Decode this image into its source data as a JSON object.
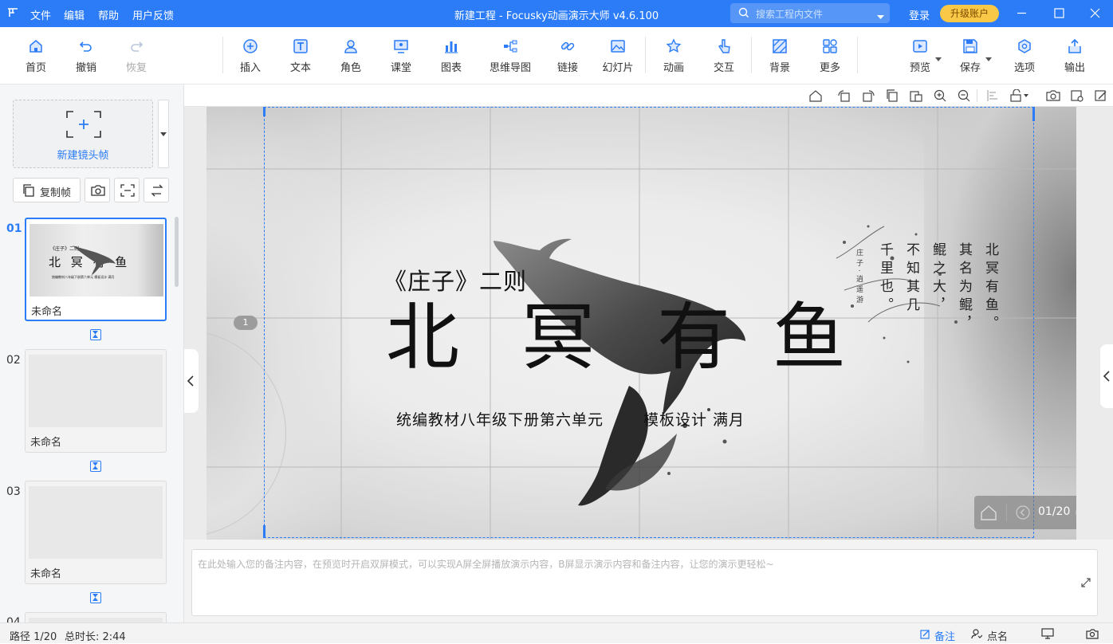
{
  "titlebar": {
    "menus": [
      "文件",
      "编辑",
      "帮助",
      "用户反馈"
    ],
    "title": "新建工程 - Focusky动画演示大师  v4.6.100",
    "search_placeholder": "搜索工程内文件",
    "login": "登录",
    "upgrade": "升级账户"
  },
  "toolbar": {
    "home": "首页",
    "undo": "撤销",
    "redo": "恢复",
    "insert": "插入",
    "text": "文本",
    "role": "角色",
    "classroom": "课堂",
    "chart": "图表",
    "mindmap": "思维导图",
    "link": "链接",
    "slideshow": "幻灯片",
    "animation": "动画",
    "interact": "交互",
    "background": "背景",
    "more": "更多",
    "preview": "预览",
    "save": "保存",
    "options": "选项",
    "export": "输出"
  },
  "leftpanel": {
    "new_frame": "新建镜头帧",
    "copy_frame": "复制帧",
    "frames": [
      {
        "no": "01",
        "name": "未命名"
      },
      {
        "no": "02",
        "name": "未命名"
      },
      {
        "no": "03",
        "name": "未命名"
      },
      {
        "no": "04",
        "name": ""
      }
    ],
    "thumb1": {
      "small_title": "《庄子》二则",
      "big_title": "北 冥 有 鱼",
      "subtitle": "统编教材八年级下册第六单元   模板设计 满月"
    }
  },
  "slide": {
    "small_title": "《庄子》二则",
    "big_chars": [
      "北",
      "冥",
      "有",
      "鱼"
    ],
    "subtitle": "统编教材八年级下册第六单元",
    "design": "模板设计 满月",
    "vertical_poem": [
      "北冥有鱼。",
      "其名为鲲，",
      "鲲之大，",
      "不知其几",
      "千里也。"
    ],
    "side_vertical": [
      "庄子·逍遥游"
    ],
    "frame_marker": "1",
    "nav_page": "01/20"
  },
  "notes": {
    "placeholder": "在此处输入您的备注内容，在预览时开启双屏模式，可以实现A屏全屏播放演示内容，B屏显示演示内容和备注内容，让您的演示更轻松~"
  },
  "statusbar": {
    "path": "路径 1/20",
    "duration": "总时长: 2:44",
    "notes_label": "备注",
    "rollcall_label": "点名"
  },
  "colors": {
    "brand": "#2b7cf6",
    "upgrade": "#f9c846"
  }
}
